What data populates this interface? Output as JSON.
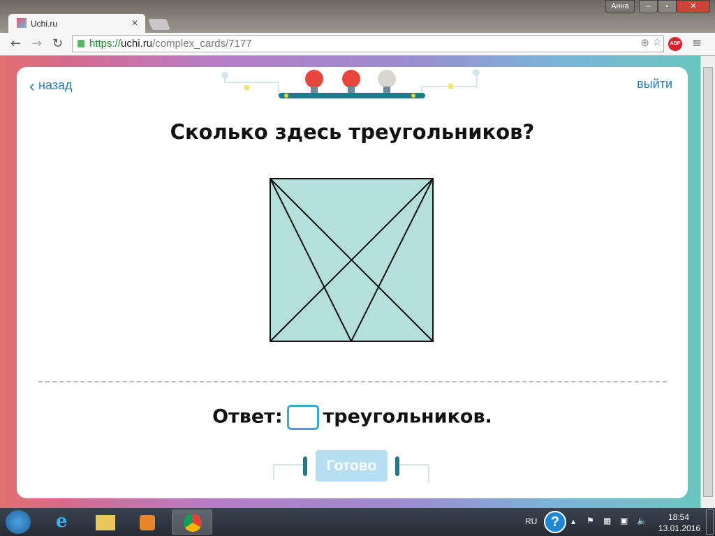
{
  "browser": {
    "tab_title": "Uchi.ru",
    "user": "Анна",
    "url_scheme": "https://",
    "url_host": "uchi.ru",
    "url_path": "/complex_cards/7177",
    "abp_label": "ABP"
  },
  "card": {
    "back_label": "назад",
    "exit_label": "выйти",
    "question": "Сколько здесь треугольников?",
    "answer_prefix": "Ответ:",
    "answer_value": "",
    "answer_suffix": "треугольников.",
    "done_label": "Готово",
    "lamps": [
      {
        "state": "on",
        "color": "#e8453c"
      },
      {
        "state": "on",
        "color": "#e8453c"
      },
      {
        "state": "off",
        "color": "#d9d6cf"
      }
    ],
    "figure_fill": "#b4dfda"
  },
  "taskbar": {
    "lang": "RU",
    "time": "18:54",
    "date": "13.01.2016"
  }
}
